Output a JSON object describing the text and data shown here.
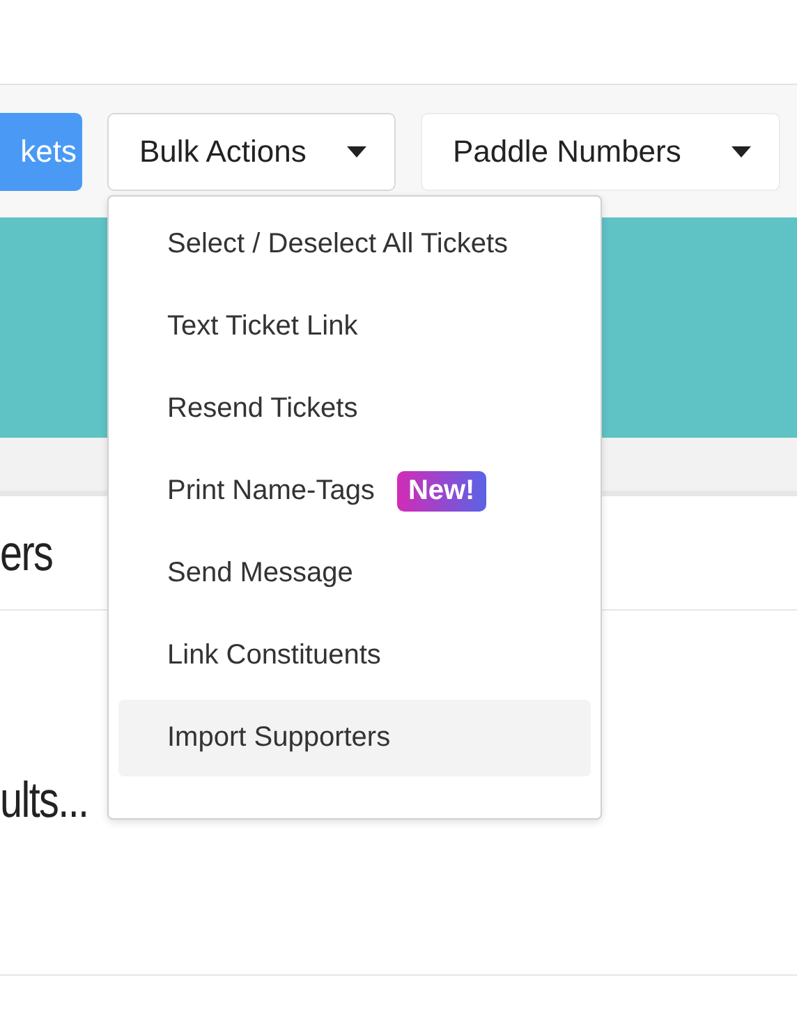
{
  "toolbar": {
    "buttons": [
      {
        "label": "kets",
        "kind": "primary"
      },
      {
        "label": "Bulk Actions",
        "kind": "dropdown"
      },
      {
        "label": "Paddle Numbers",
        "kind": "dropdown"
      }
    ]
  },
  "section": {
    "heading": "ers",
    "status": "ults..."
  },
  "menu": {
    "items": [
      {
        "label": "Select / Deselect All Tickets",
        "selected": false
      },
      {
        "label": "Text Ticket Link",
        "selected": false
      },
      {
        "label": "Resend Tickets",
        "selected": false
      },
      {
        "label": "Print Name-Tags",
        "badge": "New!",
        "selected": false
      },
      {
        "label": "Send Message",
        "selected": false
      },
      {
        "label": "Link Constituents",
        "selected": false
      },
      {
        "label": "Import Supporters",
        "selected": true
      }
    ]
  }
}
